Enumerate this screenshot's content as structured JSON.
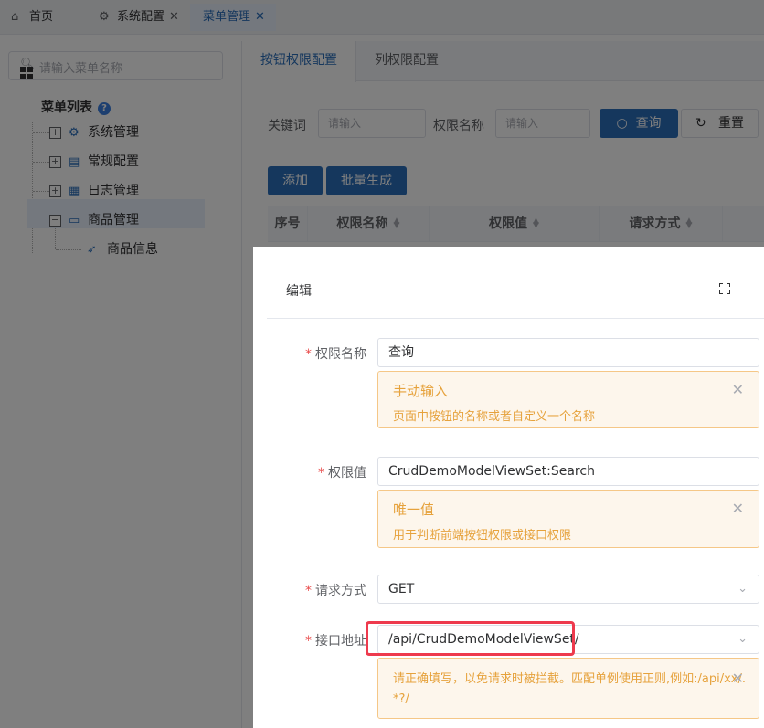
{
  "tabs": [
    {
      "label": "首页",
      "icon": "home-icon"
    },
    {
      "label": "系统配置",
      "icon": "settings-icon",
      "closable": true
    },
    {
      "label": "菜单管理",
      "active": true,
      "closable": true
    }
  ],
  "sidebar": {
    "search_placeholder": "请输入菜单名称",
    "root_label": "菜单列表",
    "tree": [
      {
        "label": "系统管理",
        "icon": "gear-icon",
        "expanded": false
      },
      {
        "label": "常规配置",
        "icon": "form-icon",
        "expanded": false
      },
      {
        "label": "日志管理",
        "icon": "log-icon",
        "expanded": false
      },
      {
        "label": "商品管理",
        "icon": "shop-icon",
        "expanded": true
      },
      {
        "label": "商品信息",
        "icon": "rocket-icon",
        "selected": true
      }
    ]
  },
  "main": {
    "subtabs": [
      "按钮权限配置",
      "列权限配置"
    ],
    "filter": {
      "keyword_label": "关键词",
      "keyword_placeholder": "请输入",
      "perm_name_label": "权限名称",
      "perm_name_placeholder": "请输入",
      "query_button": "查询",
      "reset_button": "重置"
    },
    "actions": {
      "add": "添加",
      "batch": "批量生成"
    },
    "table_headers": [
      "序号",
      "权限名称",
      "权限值",
      "请求方式"
    ]
  },
  "dialog": {
    "title": "编辑",
    "fields": [
      {
        "label": "权限名称",
        "value": "查询",
        "alert_title": "手动输入",
        "alert_desc": "页面中按钮的名称或者自定义一个名称"
      },
      {
        "label": "权限值",
        "value": "CrudDemoModelViewSet:Search",
        "alert_title": "唯一值",
        "alert_desc": "用于判断前端按钮权限或接口权限"
      },
      {
        "label": "请求方式",
        "value": "GET"
      },
      {
        "label": "接口地址",
        "value": "/api/CrudDemoModelViewSet/",
        "alert_desc": "请正确填写，以免请求时被拦截。匹配单例使用正则,例如:/api/xx/.*?/"
      }
    ]
  },
  "colors": {
    "primary": "#2a6ebb",
    "warning": "#e6a23c",
    "required": "#e94c4c",
    "highlight": "#ee3a4d"
  }
}
